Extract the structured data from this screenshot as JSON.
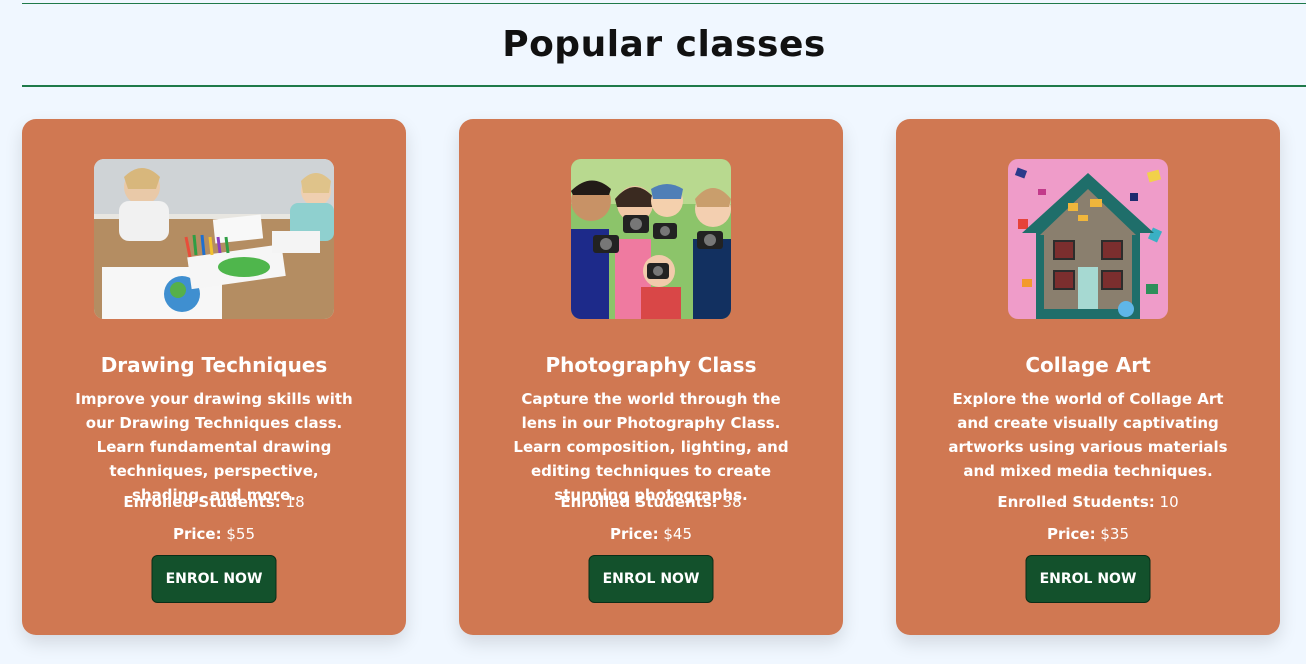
{
  "section": {
    "title": "Popular classes"
  },
  "classes": [
    {
      "name": "Drawing Techniques",
      "description": "Improve your drawing skills with our Drawing Techniques class. Learn fundamental drawing techniques, perspective, shading, and more.",
      "enrolled_label": "Enrolled Students:",
      "enrolled_value": "18",
      "price_label": "Price:",
      "price_value": "$55",
      "button_label": "ENROL NOW",
      "image_alt": "children-drawing-photo"
    },
    {
      "name": "Photography Class",
      "description": "Capture the world through the lens in our Photography Class. Learn composition, lighting, and editing techniques to create stunning photographs.",
      "enrolled_label": "Enrolled Students:",
      "enrolled_value": "38",
      "price_label": "Price:",
      "price_value": "$45",
      "button_label": "ENROL NOW",
      "image_alt": "kids-with-cameras-photo"
    },
    {
      "name": "Collage Art",
      "description": "Explore the world of Collage Art and create visually captivating artworks using various materials and mixed media techniques.",
      "enrolled_label": "Enrolled Students:",
      "enrolled_value": "10",
      "price_label": "Price:",
      "price_value": "$35",
      "button_label": "ENROL NOW",
      "image_alt": "collage-house-artwork"
    }
  ],
  "colors": {
    "card": "#d07852",
    "button": "#13512c",
    "rule": "#1f7a4a",
    "background": "#f0f7ff"
  }
}
